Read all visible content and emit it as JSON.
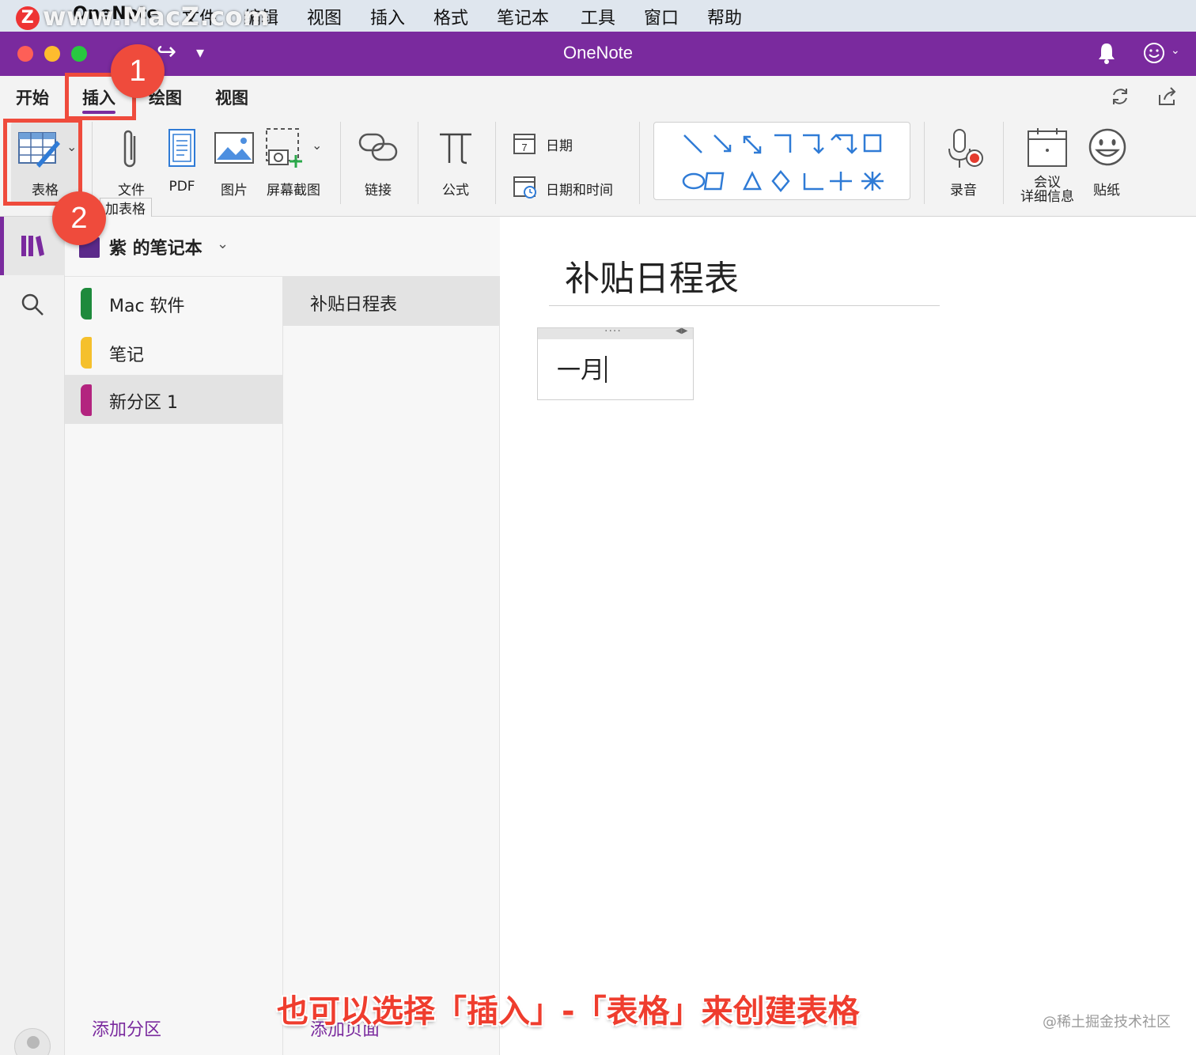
{
  "menubar": {
    "app_name": "OneNote",
    "items": [
      "文件",
      "编辑",
      "视图",
      "插入",
      "格式",
      "笔记本",
      "工具",
      "窗口",
      "帮助"
    ],
    "watermark": "www.MacZ.com",
    "watermark_logo": "Z"
  },
  "window": {
    "title": "OneNote",
    "redo_icon": "redo-arrow-icon",
    "accent_color": "#7a2a9e"
  },
  "ribbon_tabs": [
    {
      "label": "开始",
      "active": false
    },
    {
      "label": "插入",
      "active": true
    },
    {
      "label": "绘图",
      "active": false
    },
    {
      "label": "视图",
      "active": false
    }
  ],
  "ribbon": {
    "table_label": "表格",
    "file_label": "文件",
    "pdf_label": "PDF",
    "picture_label": "图片",
    "screenshot_label": "屏幕截图",
    "link_label": "链接",
    "equation_label": "公式",
    "date_label": "日期",
    "datetime_label": "日期和时间",
    "date_icon_day": "7",
    "audio_label": "录音",
    "meeting_label_1": "会议",
    "meeting_label_2": "详细信息",
    "sticker_label": "贴纸"
  },
  "tooltip": "加表格",
  "annotations": {
    "step1": "1",
    "step2": "2",
    "caption": "也可以选择「插入」-「表格」来创建表格",
    "credit": "@稀土掘金技术社区",
    "highlight_color": "#ef4b3c"
  },
  "notebook": {
    "name": "紫 的笔记本",
    "sections": [
      {
        "name": "Mac 软件",
        "color": "#1e8a3c",
        "selected": false
      },
      {
        "name": "笔记",
        "color": "#f5c02c",
        "selected": false
      },
      {
        "name": "新分区 1",
        "color": "#b3247f",
        "selected": true
      }
    ],
    "pages": [
      {
        "name": "补贴日程表",
        "selected": true
      }
    ],
    "add_section": "添加分区",
    "add_page": "添加页面"
  },
  "page": {
    "title": "补贴日程表",
    "note_text": "一月"
  }
}
